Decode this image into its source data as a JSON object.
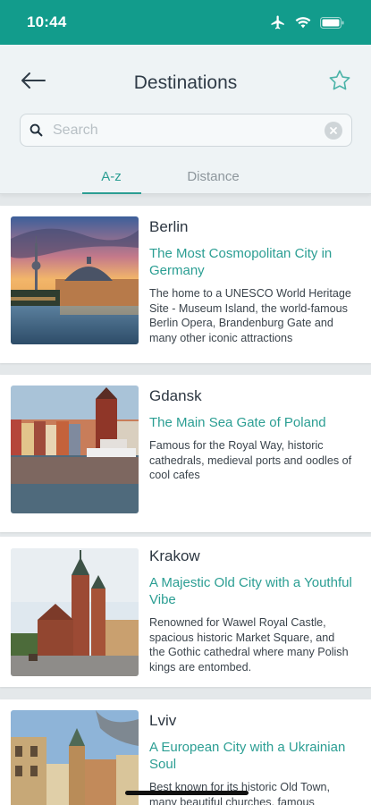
{
  "status_bar": {
    "time": "10:44",
    "icons": [
      "airplane-icon",
      "wifi-icon",
      "battery-icon"
    ]
  },
  "header": {
    "title": "Destinations",
    "back_icon": "arrow-left-icon",
    "favorite_icon": "star-outline-icon"
  },
  "search": {
    "placeholder": "Search",
    "value": ""
  },
  "tabs": [
    {
      "label": "A-z",
      "active": true
    },
    {
      "label": "Distance",
      "active": false
    }
  ],
  "destinations": [
    {
      "city": "Berlin",
      "tagline": "The Most Cosmopolitan City in Germany",
      "description": "The home to a UNESCO World Heritage Site - Museum Island, the world-famous Berlin Opera, Brandenburg Gate and many other iconic attractions"
    },
    {
      "city": "Gdansk",
      "tagline": "The Main Sea Gate of Poland",
      "description": "Famous for the Royal Way, historic cathedrals, medieval ports and oodles of cool cafes"
    },
    {
      "city": "Krakow",
      "tagline": "A Majestic Old City with a Youthful Vibe",
      "description": "Renowned for Wawel Royal Castle, spacious historic Market Square, and the Gothic cathedral where many Polish kings are entombed."
    },
    {
      "city": "Lviv",
      "tagline": "A European City with a Ukrainian Soul",
      "description": "Best known for its historic Old Town, many beautiful churches, famous"
    }
  ],
  "colors": {
    "accent": "#129c8c",
    "tab_active": "#2b9e93",
    "header_bg": "#eef3f5"
  }
}
